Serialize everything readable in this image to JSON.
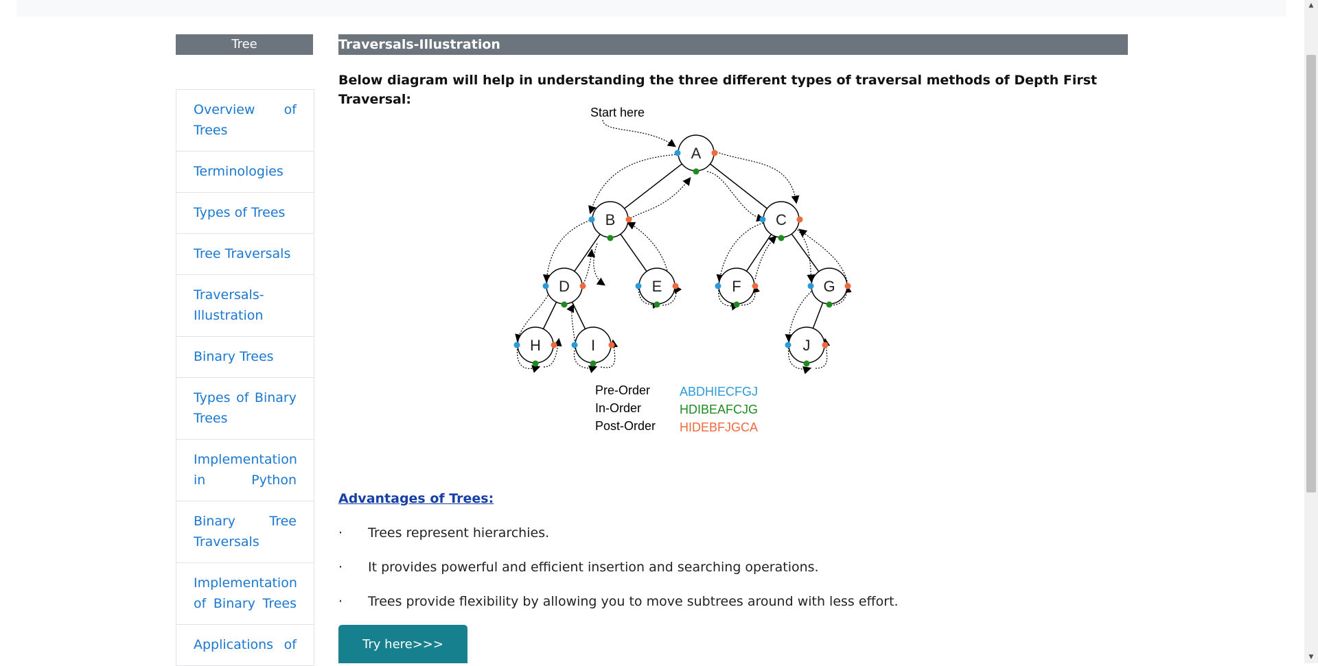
{
  "sidebar": {
    "title": "Tree",
    "items": [
      {
        "label": "Overview of Trees",
        "single": false
      },
      {
        "label": "Terminologies",
        "single": true
      },
      {
        "label": "Types of Trees",
        "single": true
      },
      {
        "label": "Tree Traversals",
        "single": true
      },
      {
        "label": "Traversals-Illustration",
        "single": false
      },
      {
        "label": "Binary Trees",
        "single": true
      },
      {
        "label": "Types of Binary Trees",
        "single": false
      },
      {
        "label": "Implementation in Python",
        "single": false
      },
      {
        "label": "Binary Tree Traversals",
        "single": false
      },
      {
        "label": "Implementation of Binary Trees",
        "single": false
      },
      {
        "label": "Applications of",
        "single": false
      }
    ]
  },
  "main": {
    "title": "Traversals-Illustration",
    "intro": "Below diagram will help in understanding the three different types of traversal methods of Depth First Traversal:",
    "diagram": {
      "start_label": "Start here",
      "nodes": [
        "A",
        "B",
        "C",
        "D",
        "E",
        "F",
        "G",
        "H",
        "I",
        "J"
      ],
      "legend": [
        {
          "name": "Pre-Order",
          "value": "ABDHIECFGJ",
          "color": "#2a9ad8"
        },
        {
          "name": "In-Order",
          "value": "HDIBEAFCJG",
          "color": "#1f8a1f"
        },
        {
          "name": "Post-Order",
          "value": "HIDEBFJGCA",
          "color": "#ef6a3c"
        }
      ]
    },
    "advantages_title": "Advantages of Trees:",
    "bullet_char": "·",
    "bullets": [
      "Trees represent hierarchies.",
      "It provides powerful and efficient insertion and searching operations.",
      "Trees provide flexibility by allowing you to move subtrees around with less effort."
    ],
    "try_button": "Try here>>>"
  },
  "icons": {
    "scroll_up": "arrow-up-icon",
    "scroll_down": "arrow-down-icon"
  }
}
